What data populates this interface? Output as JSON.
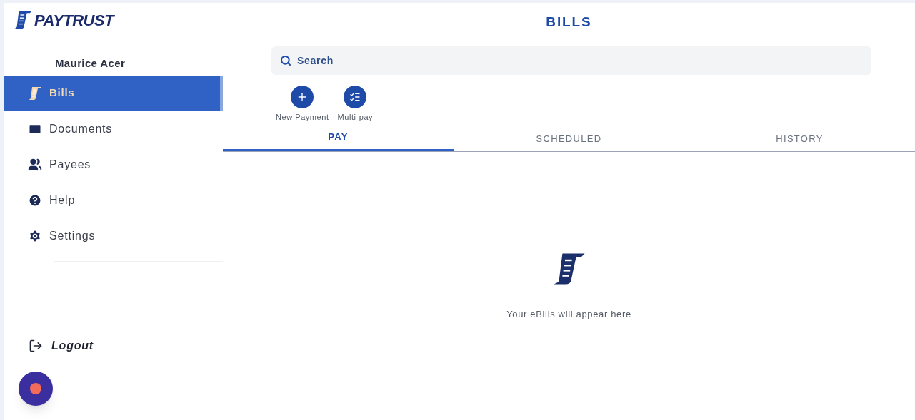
{
  "logo": {
    "text": "PAYTRUST"
  },
  "page_title": "BILLS",
  "user_name": "Maurice Acer",
  "nav": [
    {
      "kind": "bills",
      "label": "Bills",
      "selected": true
    },
    {
      "kind": "documents",
      "label": "Documents",
      "selected": false
    },
    {
      "kind": "payees",
      "label": "Payees",
      "selected": false
    },
    {
      "kind": "help",
      "label": "Help",
      "selected": false
    },
    {
      "kind": "settings",
      "label": "Settings",
      "selected": false
    }
  ],
  "logout": "Logout",
  "search": {
    "placeholder": "Search"
  },
  "actions": [
    {
      "kind": "new",
      "label": "New Payment"
    },
    {
      "kind": "multi",
      "label": "Multi-pay"
    }
  ],
  "tabs": [
    {
      "label": "PAY",
      "selected": true
    },
    {
      "label": "SCHEDULED",
      "selected": false
    },
    {
      "label": "HISTORY",
      "selected": false
    }
  ],
  "empty_message": "Your eBills will appear here"
}
